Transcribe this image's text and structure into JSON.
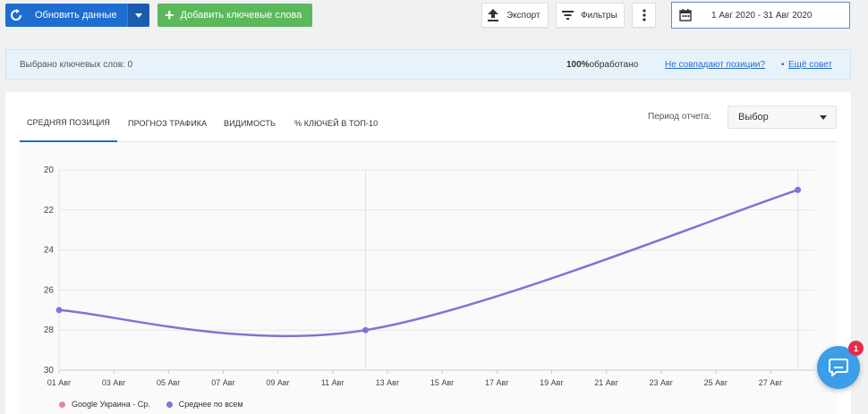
{
  "toolbar": {
    "refresh_label": "Обновить данные",
    "add_keywords_label": "Добавить ключевые слова",
    "export_label": "Экспорт",
    "filters_label": "Фильтры",
    "date_range": "1 Авг 2020 - 31 Авг 2020"
  },
  "infobar": {
    "selected_keywords": "Выбрано ключевых слов: 0",
    "processed_percent": "100%",
    "processed_label": "обработано",
    "link_mismatch": "Не совпадают позиции?",
    "separator": "•",
    "link_more_tips": "Ещё совет"
  },
  "tabs": [
    {
      "label": "СРЕДНЯЯ ПОЗИЦИЯ",
      "active": true
    },
    {
      "label": "ПРОГНОЗ ТРАФИКА",
      "active": false
    },
    {
      "label": "ВИДИМОСТЬ",
      "active": false
    },
    {
      "label": "% КЛЮЧЕЙ В ТОП-10",
      "active": false
    }
  ],
  "period": {
    "label": "Период отчета:",
    "selected": "Выбор"
  },
  "chat": {
    "badge_count": "1"
  },
  "colors": {
    "primary": "#1e6dd1",
    "success": "#5cb85c",
    "series_avg": "#8a6fd3",
    "series_google": "#e08a97"
  },
  "chart_data": {
    "type": "line",
    "title": "",
    "xlabel": "",
    "ylabel": "",
    "y_inverted": true,
    "ylim": [
      20,
      30
    ],
    "y_ticks": [
      20,
      22,
      24,
      26,
      28,
      30
    ],
    "x_ticks": [
      "01 Авг",
      "03 Авг",
      "05 Авг",
      "07 Авг",
      "09 Авг",
      "11 Авг",
      "13 Авг",
      "15 Авг",
      "17 Авг",
      "19 Авг",
      "21 Авг",
      "23 Авг",
      "25 Авг",
      "27 Авг"
    ],
    "x_range_days": [
      1,
      28.6
    ],
    "series": [
      {
        "name": "Google Украина - Ср.",
        "color": "#e08a97",
        "points": []
      },
      {
        "name": "Среднее по всем",
        "color": "#8a6fd3",
        "points": [
          {
            "x": 1,
            "y": 27
          },
          {
            "x": 12.2,
            "y": 28
          },
          {
            "x": 28,
            "y": 21
          }
        ]
      }
    ],
    "grid": true,
    "legend": "bottom-left"
  }
}
